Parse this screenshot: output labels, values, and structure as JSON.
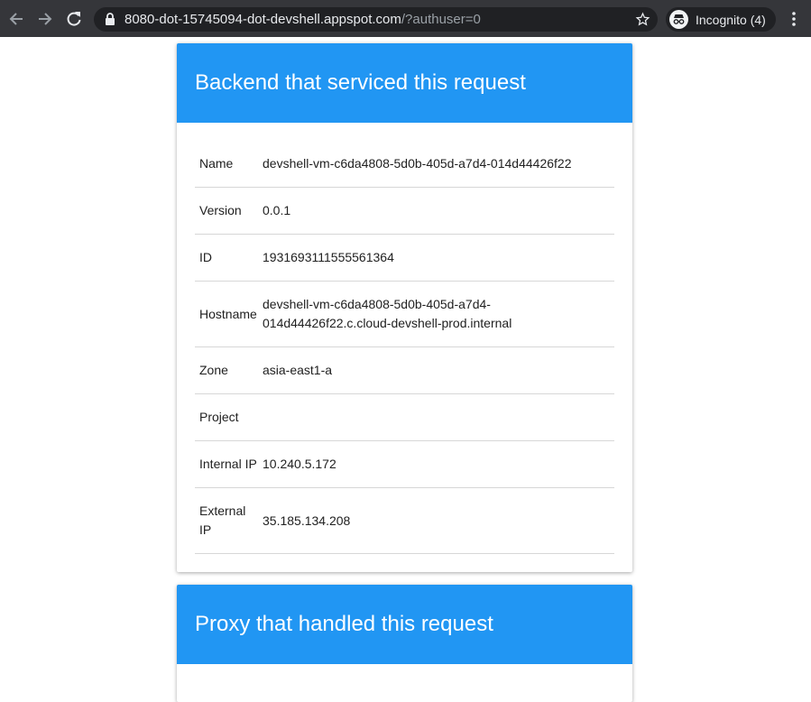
{
  "browser": {
    "url_host": "8080-dot-15745094-dot-devshell.appspot.com",
    "url_rest": "/?authuser=0",
    "incognito_label": "Incognito (4)"
  },
  "backend_card": {
    "title": "Backend that serviced this request",
    "rows": [
      {
        "key": "Name",
        "value": "devshell-vm-c6da4808-5d0b-405d-a7d4-014d44426f22"
      },
      {
        "key": "Version",
        "value": "0.0.1"
      },
      {
        "key": "ID",
        "value": "1931693111555561364"
      },
      {
        "key": "Hostname",
        "value": "devshell-vm-c6da4808-5d0b-405d-a7d4-014d44426f22.c.cloud-devshell-prod.internal"
      },
      {
        "key": "Zone",
        "value": "asia-east1-a"
      },
      {
        "key": "Project",
        "value": ""
      },
      {
        "key": "Internal IP",
        "value": "10.240.5.172"
      },
      {
        "key": "External IP",
        "value": "35.185.134.208"
      }
    ]
  },
  "proxy_card": {
    "title": "Proxy that handled this request"
  }
}
